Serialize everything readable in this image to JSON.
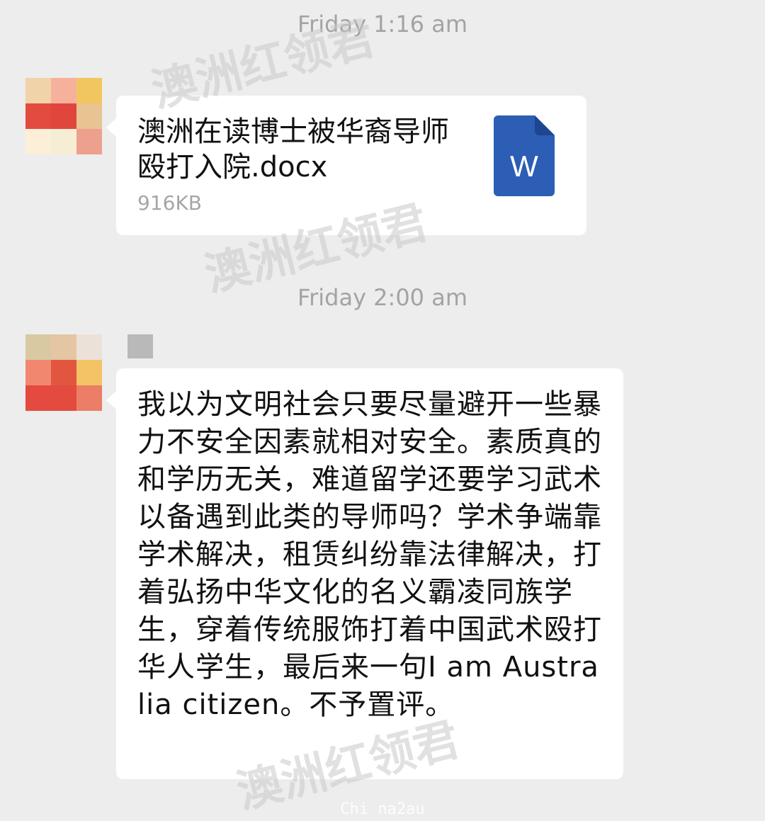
{
  "chat": {
    "messages": [
      {
        "timestamp": "Friday 1:16 am",
        "type": "file",
        "avatar_colors": [
          "#f0d3a8",
          "#f6b19d",
          "#f1c65e",
          "#e34b3f",
          "#e0463c",
          "#e8c493",
          "#fcefd8",
          "#f6eed4",
          "#eda08d"
        ],
        "file_name": "澳洲在读博士被华裔导师殴打入院.docx",
        "file_size": "916KB",
        "file_icon_label": "W",
        "file_icon_color": "#2b5eb4"
      },
      {
        "timestamp": "Friday 2:00 am",
        "type": "text",
        "avatar_colors": [
          "#d8c9a3",
          "#e4c6a3",
          "#ece1d9",
          "#f28770",
          "#e2563f",
          "#f3c366",
          "#e44a3f",
          "#e44b3f",
          "#ec7d66"
        ],
        "text": "我以为文明社会只要尽量避开一些暴力不安全因素就相对安全。素质真的和学历无关，难道留学还要学习武术以备遇到此类的导师吗？学术争端靠学术解决，租赁纠纷靠法律解决，打着弘扬中华文化的名义霸凌同族学生，穿着传统服饰打着中国武术殴打华人学生，最后来一句I am Australia citizen。不予置评。"
      }
    ]
  },
  "watermark_text": "澳洲红领君",
  "footer_watermark": "Chi na2au",
  "colors": {
    "background": "#ededed",
    "bubble": "#ffffff",
    "timestamp": "#a3a3a3",
    "file_size": "#a6a6a6"
  }
}
